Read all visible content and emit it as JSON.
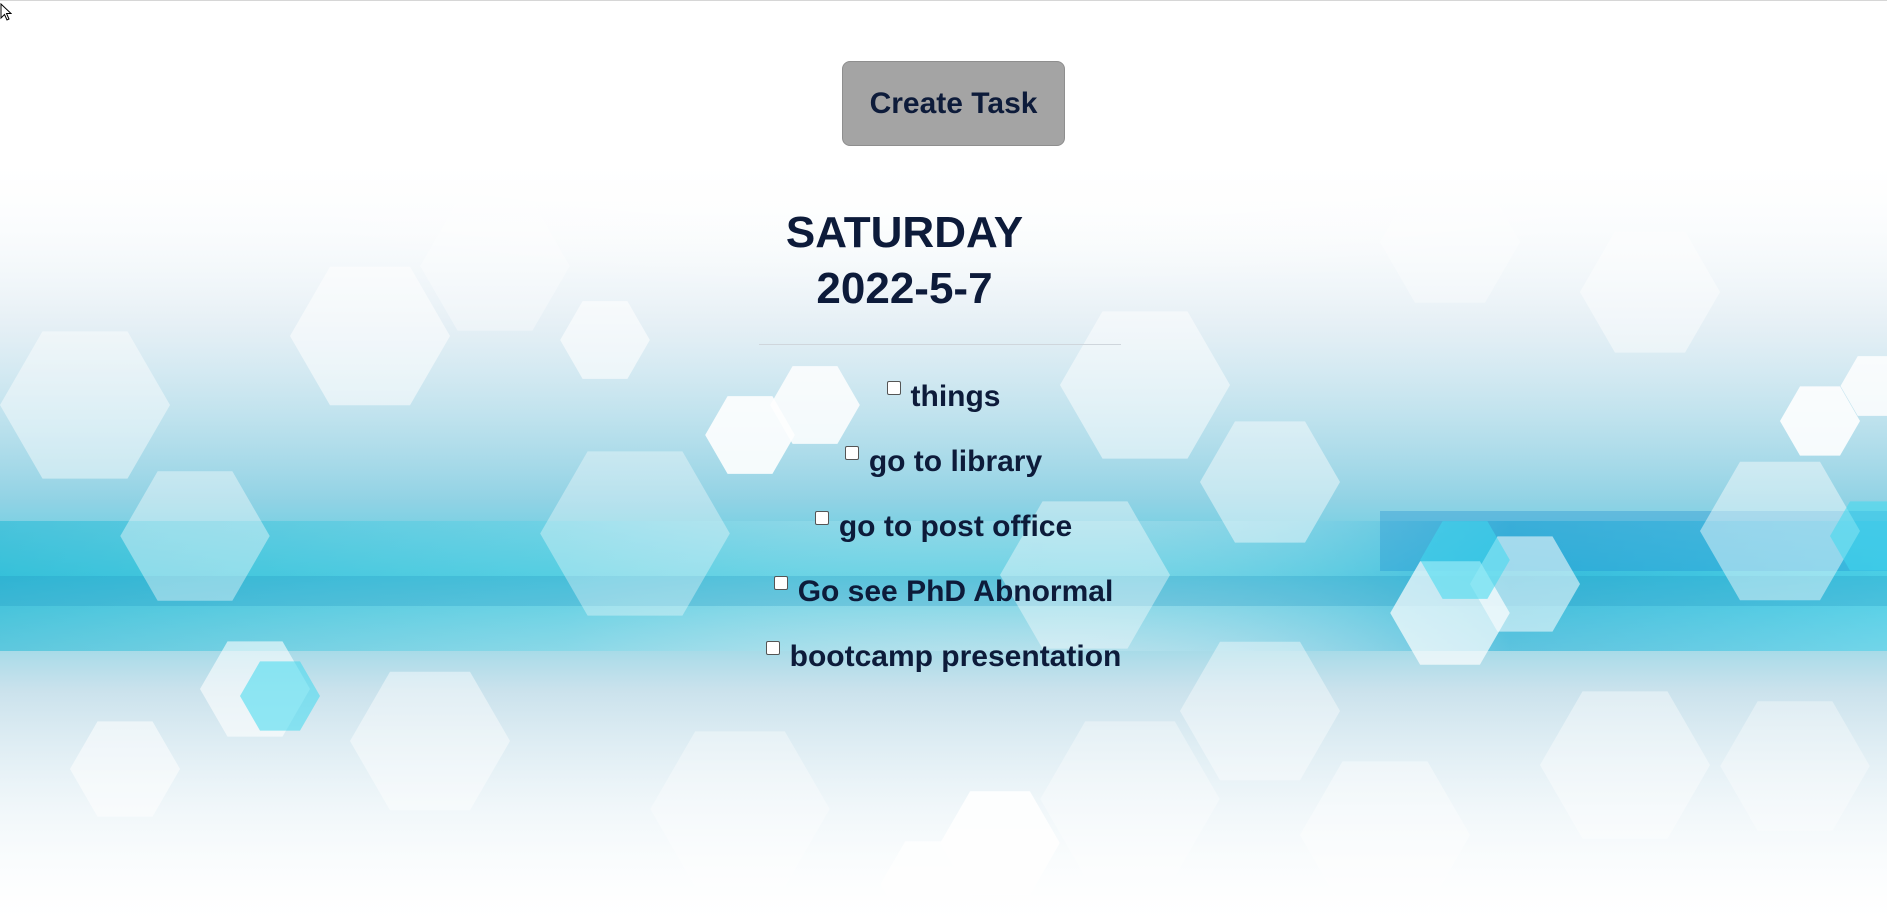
{
  "toolbar": {
    "create_label": "Create Task"
  },
  "day": {
    "weekday": "SATURDAY",
    "date": "2022-5-7"
  },
  "tasks": [
    {
      "label": "things",
      "checked": false
    },
    {
      "label": "go to library",
      "checked": false
    },
    {
      "label": "go to post office",
      "checked": false
    },
    {
      "label": "Go see PhD Abnormal",
      "checked": false
    },
    {
      "label": "bootcamp presentation",
      "checked": false
    }
  ],
  "colors": {
    "text": "#0d1b3a",
    "button": "#a4a4a4",
    "accent": "#2ec6dc"
  },
  "icons": {
    "cursor": "arrow-cursor-icon"
  }
}
